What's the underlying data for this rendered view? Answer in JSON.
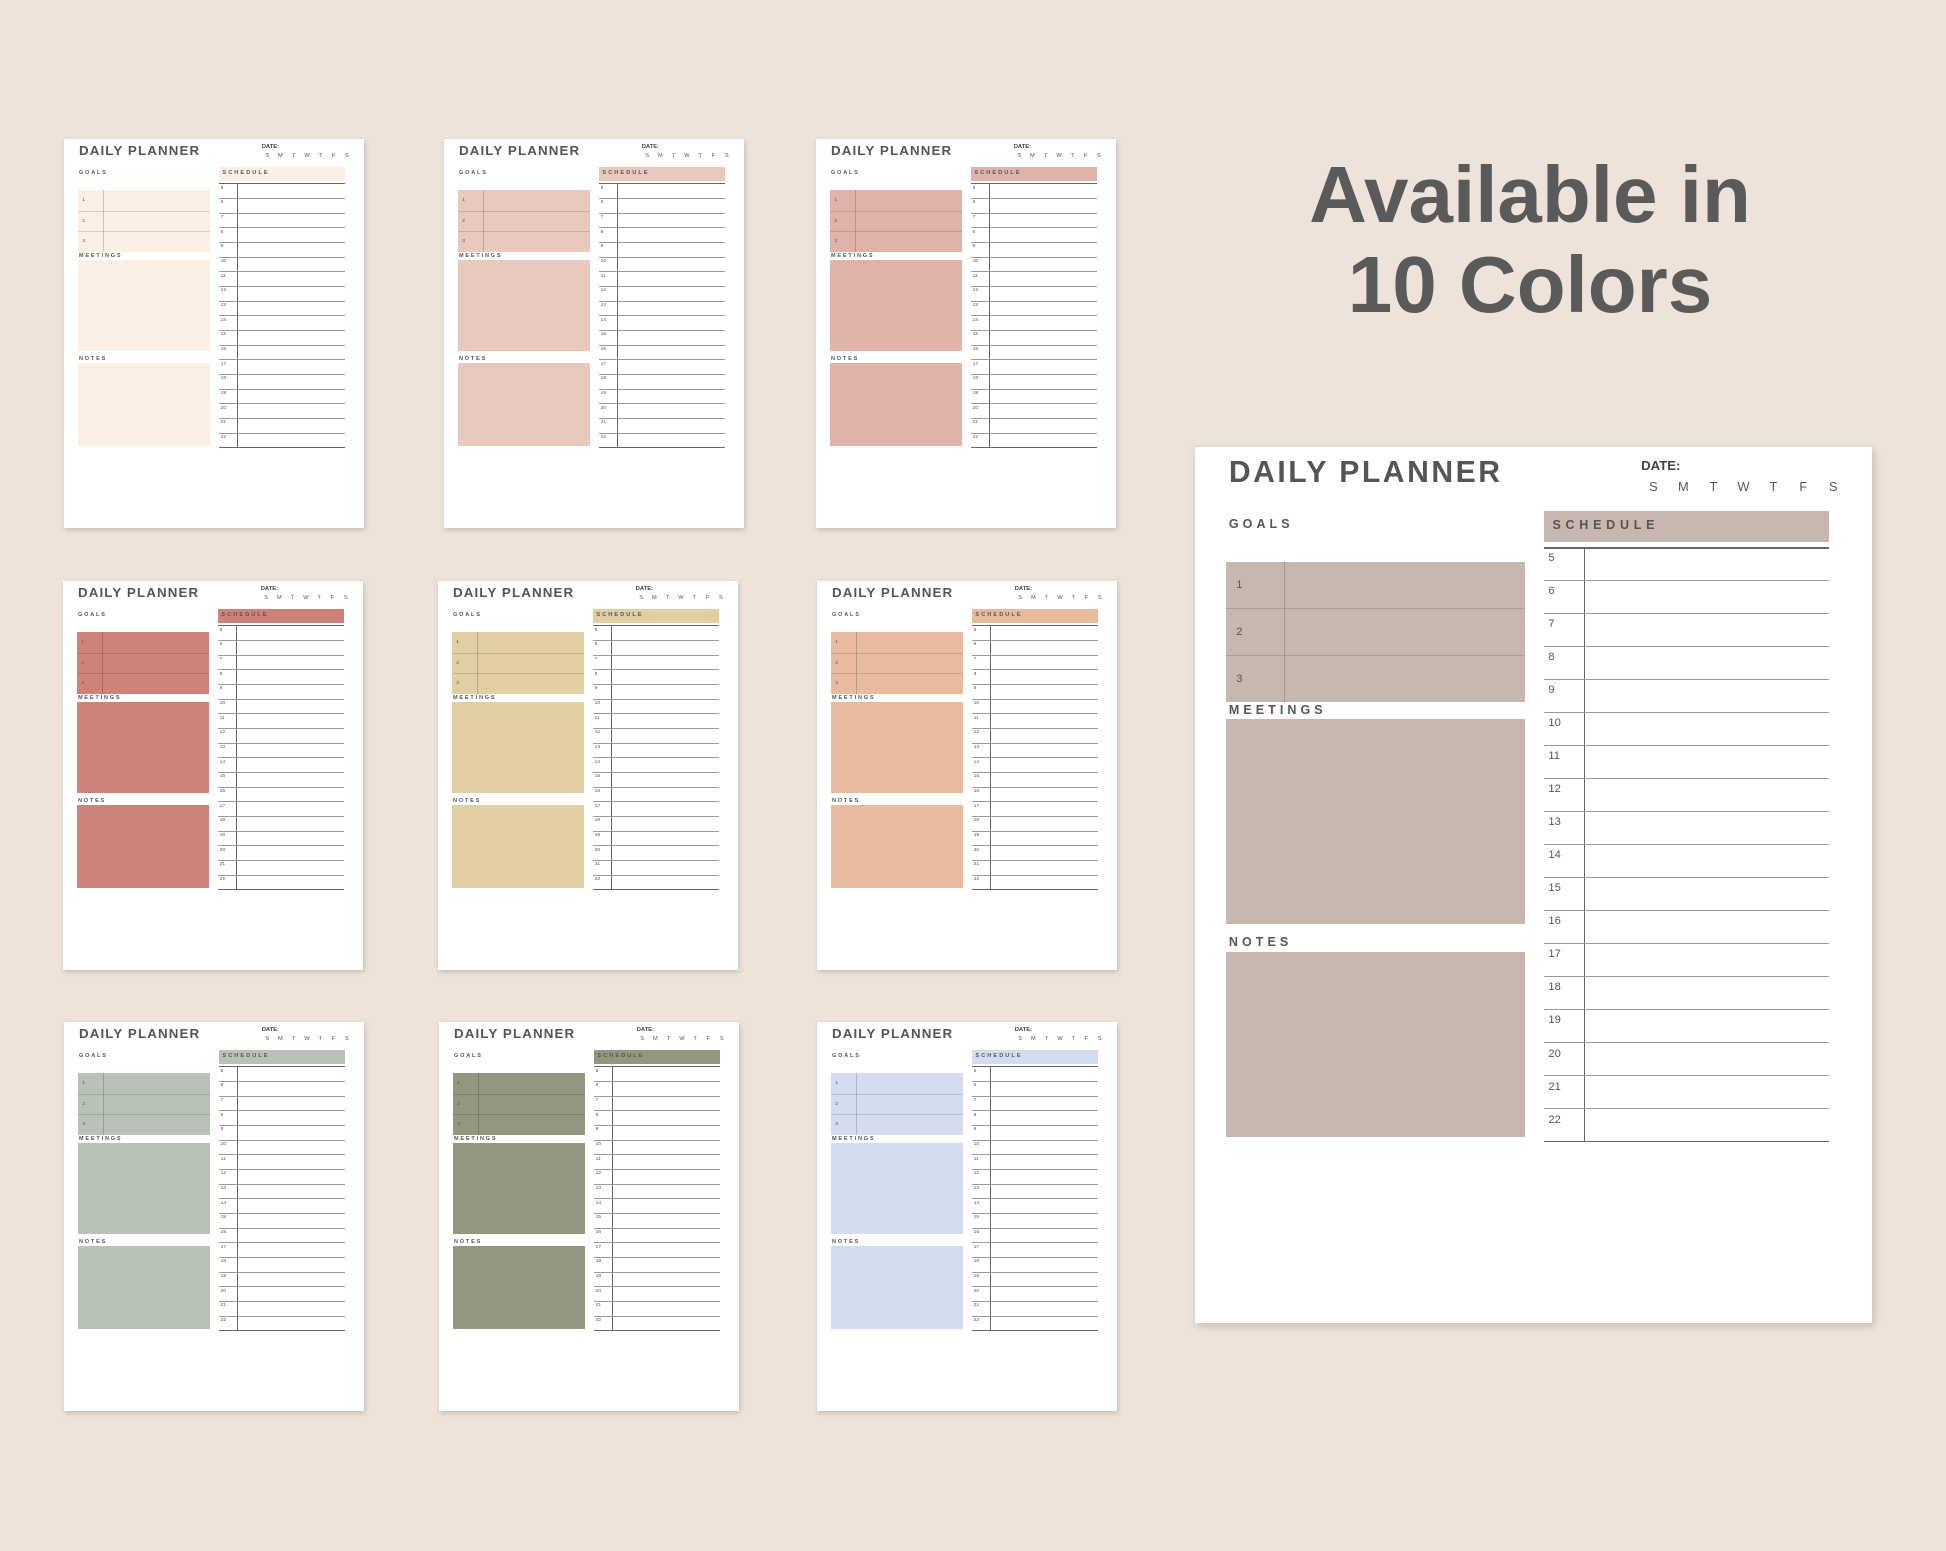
{
  "headline": {
    "line1": "Available in",
    "line2": "10 Colors"
  },
  "planner": {
    "title": "DAILY PLANNER",
    "date_label": "DATE:",
    "days": [
      "S",
      "M",
      "T",
      "W",
      "T",
      "F",
      "S"
    ],
    "goals_label": "GOALS",
    "goal_numbers": [
      "1",
      "2",
      "3"
    ],
    "meetings_label": "MEETINGS",
    "notes_label": "NOTES",
    "schedule_label": "SCHEDULE",
    "hours": [
      "5",
      "6",
      "7",
      "8",
      "9",
      "10",
      "11",
      "12",
      "13",
      "14",
      "15",
      "16",
      "17",
      "18",
      "19",
      "20",
      "21",
      "22"
    ]
  },
  "color_variants": [
    {
      "name": "cream",
      "fill": "#fcefe6"
    },
    {
      "name": "blush",
      "fill": "#e9c8bd"
    },
    {
      "name": "rose",
      "fill": "#e1b2aa"
    },
    {
      "name": "terracotta",
      "fill": "#cf8378"
    },
    {
      "name": "sand",
      "fill": "#dfcfa3"
    },
    {
      "name": "peach",
      "fill": "#e8bb9f"
    },
    {
      "name": "sage",
      "fill": "#b8c2b7"
    },
    {
      "name": "olive",
      "fill": "#94977f"
    },
    {
      "name": "periwinkle",
      "fill": "#d3ddef"
    },
    {
      "name": "taupe",
      "fill": "#c8b7af"
    }
  ]
}
